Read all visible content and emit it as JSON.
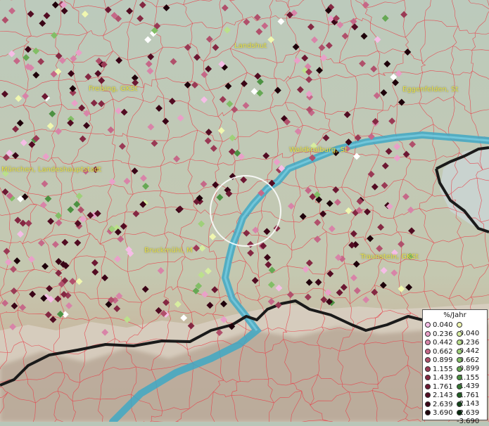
{
  "cities": [
    {
      "name": "Landshut"
    },
    {
      "name": "Freising, GKSt"
    },
    {
      "name": "Eggenfelden, St"
    },
    {
      "name": "Waldkraiburg, St"
    },
    {
      "name": "München, Landeshauptstadt"
    },
    {
      "name": "Bruckmühl, M"
    },
    {
      "name": "Traunstein, GKSt"
    }
  ],
  "legend": {
    "title": "%/Jahr",
    "positive": [
      {
        "label": "0.040",
        "color": "#f5bde6"
      },
      {
        "label": "0.236",
        "color": "#e9a0c8"
      },
      {
        "label": "0.442",
        "color": "#d884a8"
      },
      {
        "label": "0.662",
        "color": "#c56888"
      },
      {
        "label": "0.899",
        "color": "#b0506b"
      },
      {
        "label": "1.155",
        "color": "#9a3a55"
      },
      {
        "label": "1.439",
        "color": "#842842"
      },
      {
        "label": "1.761",
        "color": "#6c1832"
      },
      {
        "label": "2.143",
        "color": "#520c22"
      },
      {
        "label": "2.639",
        "color": "#3a0416"
      },
      {
        "label": "3.690",
        "color": "#1e000a"
      }
    ],
    "negative": [
      {
        "label": "-0.040",
        "color": "#f0f7b0"
      },
      {
        "label": "-0.236",
        "color": "#d7eda0"
      },
      {
        "label": "-0.442",
        "color": "#bbe08c"
      },
      {
        "label": "-0.662",
        "color": "#9fd07a"
      },
      {
        "label": "-0.899",
        "color": "#82be66"
      },
      {
        "label": "-1.155",
        "color": "#66a854"
      },
      {
        "label": "-1.439",
        "color": "#4c9142"
      },
      {
        "label": "-1.761",
        "color": "#357832"
      },
      {
        "label": "-2.143",
        "color": "#225e24"
      },
      {
        "label": "-2.639",
        "color": "#124418"
      },
      {
        "label": "-3.690",
        "color": "#062a0c"
      }
    ]
  },
  "colors": {
    "background": "#b9c6b8",
    "river": "#3fa8c4",
    "border": "#1a1a1a",
    "district_lines": "#e8404a",
    "city_label": "#e6e04a"
  }
}
